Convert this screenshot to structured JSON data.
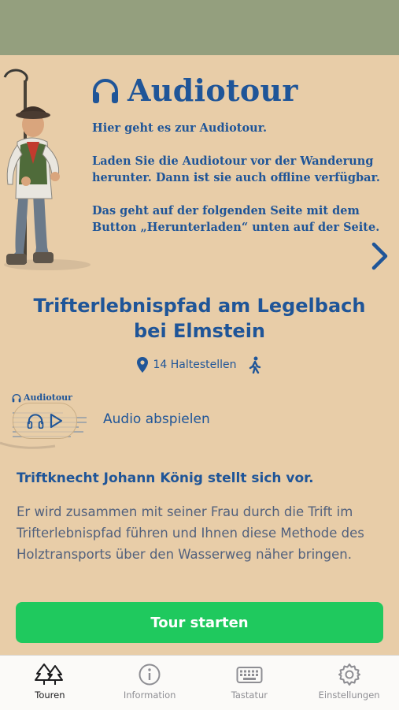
{
  "hero": {
    "heading": "Audiotour",
    "paragraphs": [
      "Hier geht es zur Audiotour.",
      "Laden Sie die Audiotour vor der Wanderung herunter. Dann ist sie auch offline verfügbar.",
      "Das geht auf der folgenden Seite mit dem Button „Herunterladen“ unten auf der Seite."
    ]
  },
  "tour": {
    "title": "Trifterlebnispfad am Legelbach bei Elmstein",
    "stops": "14 Haltestellen"
  },
  "audio": {
    "thumb_label": "Audiotour",
    "play_label": "Audio abspielen"
  },
  "intro": {
    "subtitle": "Triftknecht Johann König stellt sich vor.",
    "text": "Er wird zusammen mit seiner Frau durch die Trift im Trifterlebnispfad führen und Ihnen diese Methode des Holztransports über den Wasserweg näher bringen."
  },
  "actions": {
    "start": "Tour starten"
  },
  "tabbar": {
    "tabs": [
      {
        "label": "Touren",
        "icon": "trees-icon",
        "active": true
      },
      {
        "label": "Information",
        "icon": "info-icon",
        "active": false
      },
      {
        "label": "Tastatur",
        "icon": "keyboard-icon",
        "active": false
      },
      {
        "label": "Einstellungen",
        "icon": "gear-icon",
        "active": false
      }
    ]
  },
  "colors": {
    "top_bar": "#949f7e",
    "background": "#e8cda8",
    "primary_text": "#1f5598",
    "button": "#1fc95e"
  }
}
